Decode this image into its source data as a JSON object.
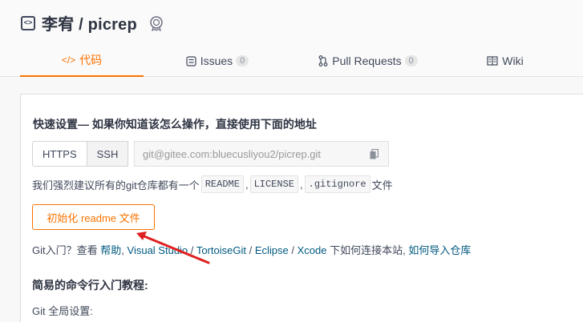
{
  "repo": {
    "title": "李宥 / picrep",
    "repo_icon_glyph": "<>",
    "badge_icon": "award-badge-icon"
  },
  "tabs": [
    {
      "icon": "</>",
      "label": "代码",
      "active": true
    },
    {
      "icon": "issues-icon",
      "label": "Issues",
      "count": "0"
    },
    {
      "icon": "pull-request-icon",
      "label": "Pull Requests",
      "count": "0"
    },
    {
      "icon": "wiki-icon",
      "label": "Wiki"
    }
  ],
  "quick_setup": {
    "title": "快速设置— 如果你知道该怎么操作，直接使用下面的地址",
    "https_label": "HTTPS",
    "ssh_label": "SSH",
    "clone_url": "git@gitee.com:bluecusliyou2/picrep.git",
    "suggest_prefix": "我们强烈建议所有的git仓库都有一个",
    "chip_readme": "README",
    "sep1": ",",
    "chip_license": "LICENSE",
    "sep2": ",",
    "chip_gitignore": ".gitignore",
    "suggest_suffix": "文件",
    "init_button": "初始化 readme 文件",
    "help_prefix": "Git入门？查看",
    "help_link": "帮助",
    "help_comma": ",",
    "link_vs": "Visual Studio",
    "slash1": "/",
    "link_tortoise": "TortoiseGit",
    "slash2": "/",
    "link_eclipse": "Eclipse",
    "slash3": "/",
    "link_xcode": "Xcode",
    "help_mid": "下如何连接本站,",
    "link_import": "如何导入仓库"
  },
  "tutorial": {
    "title": "简易的命令行入门教程:",
    "global_setting": "Git 全局设置:"
  },
  "colors": {
    "accent": "#fe7300",
    "link": "#005980",
    "arrow": "#e02020"
  }
}
